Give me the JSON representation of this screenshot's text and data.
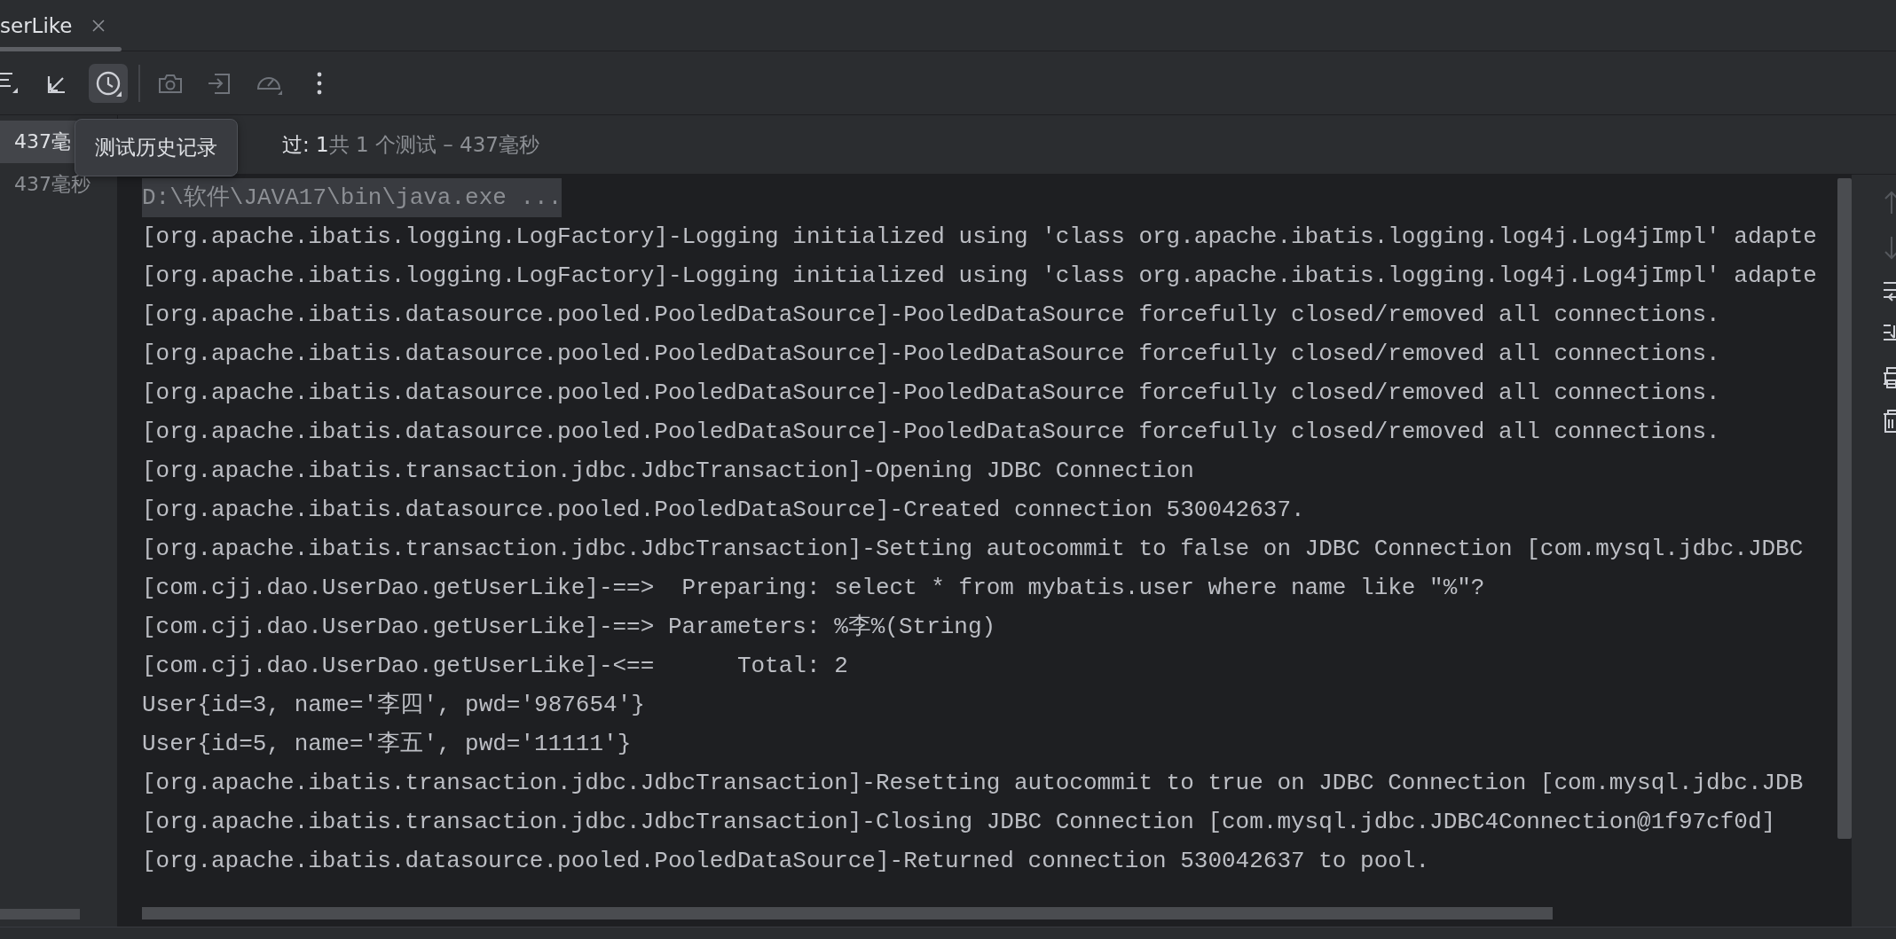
{
  "tab": {
    "label": "serLike",
    "selected": true
  },
  "toolbar": {
    "items": [
      {
        "kind": "list",
        "selected": false,
        "disabled": false
      },
      {
        "kind": "collapse",
        "selected": false,
        "disabled": false
      },
      {
        "kind": "history",
        "selected": true,
        "disabled": false
      },
      {
        "kind": "divider"
      },
      {
        "kind": "camera",
        "selected": false,
        "disabled": true
      },
      {
        "kind": "import",
        "selected": false,
        "disabled": true
      },
      {
        "kind": "gauge",
        "selected": false,
        "disabled": true
      },
      {
        "kind": "more",
        "selected": false,
        "disabled": false
      }
    ]
  },
  "tooltip": {
    "text": "测试历史记录"
  },
  "tree": {
    "rows": [
      {
        "duration": "437毫",
        "selected": true
      },
      {
        "duration": "437毫秒",
        "selected": false
      }
    ]
  },
  "status": {
    "passed": "过: 1",
    "summary": "共 1 个测试 – 437毫秒"
  },
  "console": {
    "lines": [
      {
        "kind": "command",
        "text": "D:\\软件\\JAVA17\\bin\\java.exe ..."
      },
      {
        "kind": "output",
        "text": "[org.apache.ibatis.logging.LogFactory]-Logging initialized using 'class org.apache.ibatis.logging.log4j.Log4jImpl' adapte"
      },
      {
        "kind": "output",
        "text": "[org.apache.ibatis.logging.LogFactory]-Logging initialized using 'class org.apache.ibatis.logging.log4j.Log4jImpl' adapte"
      },
      {
        "kind": "output",
        "text": "[org.apache.ibatis.datasource.pooled.PooledDataSource]-PooledDataSource forcefully closed/removed all connections."
      },
      {
        "kind": "output",
        "text": "[org.apache.ibatis.datasource.pooled.PooledDataSource]-PooledDataSource forcefully closed/removed all connections."
      },
      {
        "kind": "output",
        "text": "[org.apache.ibatis.datasource.pooled.PooledDataSource]-PooledDataSource forcefully closed/removed all connections."
      },
      {
        "kind": "output",
        "text": "[org.apache.ibatis.datasource.pooled.PooledDataSource]-PooledDataSource forcefully closed/removed all connections."
      },
      {
        "kind": "output",
        "text": "[org.apache.ibatis.transaction.jdbc.JdbcTransaction]-Opening JDBC Connection"
      },
      {
        "kind": "output",
        "text": "[org.apache.ibatis.datasource.pooled.PooledDataSource]-Created connection 530042637."
      },
      {
        "kind": "output",
        "text": "[org.apache.ibatis.transaction.jdbc.JdbcTransaction]-Setting autocommit to false on JDBC Connection [com.mysql.jdbc.JDBC"
      },
      {
        "kind": "output",
        "text": "[com.cjj.dao.UserDao.getUserLike]-==>  Preparing: select * from mybatis.user where name like \"%\"?"
      },
      {
        "kind": "output",
        "text": "[com.cjj.dao.UserDao.getUserLike]-==> Parameters: %李%(String)"
      },
      {
        "kind": "output",
        "text": "[com.cjj.dao.UserDao.getUserLike]-<==      Total: 2"
      },
      {
        "kind": "output",
        "text": "User{id=3, name='李四', pwd='987654'}"
      },
      {
        "kind": "output",
        "text": "User{id=5, name='李五', pwd='11111'}"
      },
      {
        "kind": "output",
        "text": "[org.apache.ibatis.transaction.jdbc.JdbcTransaction]-Resetting autocommit to true on JDBC Connection [com.mysql.jdbc.JDB"
      },
      {
        "kind": "output",
        "text": "[org.apache.ibatis.transaction.jdbc.JdbcTransaction]-Closing JDBC Connection [com.mysql.jdbc.JDBC4Connection@1f97cf0d]"
      },
      {
        "kind": "output",
        "text": "[org.apache.ibatis.datasource.pooled.PooledDataSource]-Returned connection 530042637 to pool."
      }
    ]
  }
}
